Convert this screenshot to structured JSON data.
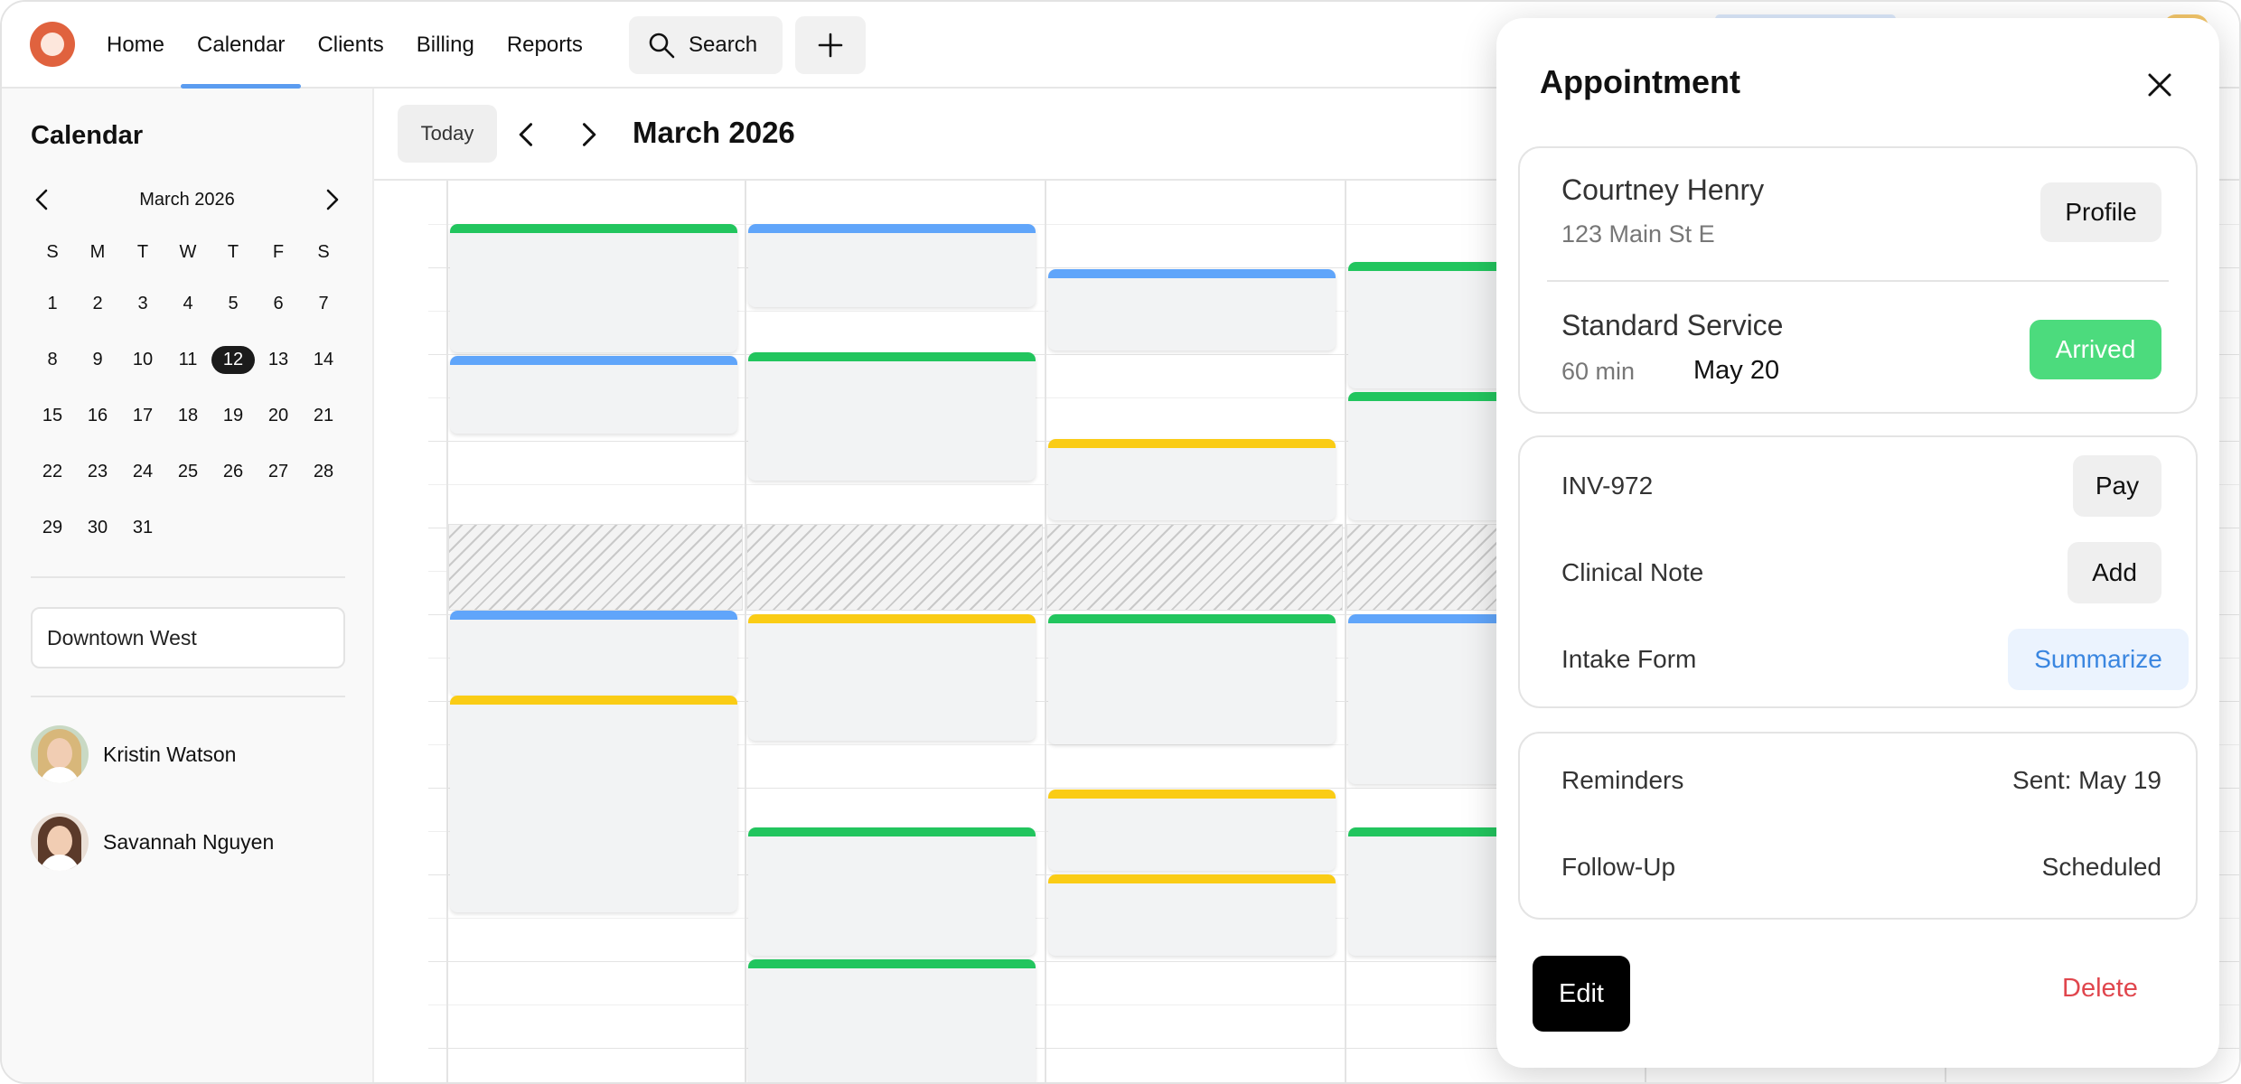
{
  "nav": {
    "items": [
      {
        "label": "Home",
        "active": false
      },
      {
        "label": "Calendar",
        "active": true
      },
      {
        "label": "Clients",
        "active": false
      },
      {
        "label": "Billing",
        "active": false
      },
      {
        "label": "Reports",
        "active": false
      }
    ],
    "search_label": "Search",
    "icons": {
      "search": "search-icon",
      "add": "plus-icon",
      "logo": "app-logo"
    },
    "accent_color": "#5b9cf0"
  },
  "sidebar": {
    "title": "Calendar",
    "mini_calendar": {
      "month_label": "March 2026",
      "weekdays": [
        "S",
        "M",
        "T",
        "W",
        "T",
        "F",
        "S"
      ],
      "days": [
        "1",
        "2",
        "3",
        "4",
        "5",
        "6",
        "7",
        "8",
        "9",
        "10",
        "11",
        "12",
        "13",
        "14",
        "15",
        "16",
        "17",
        "18",
        "19",
        "20",
        "21",
        "22",
        "23",
        "24",
        "25",
        "26",
        "27",
        "28",
        "29",
        "30",
        "31"
      ],
      "selected_day": "12"
    },
    "location_value": "Downtown West",
    "staff": [
      {
        "name": "Kristin Watson"
      },
      {
        "name": "Savannah Nguyen"
      }
    ]
  },
  "toolbar": {
    "today_label": "Today",
    "title": "March 2026"
  },
  "calendar": {
    "status_colors": {
      "green": "#22c55e",
      "blue": "#60a5fa",
      "yellow": "#facc15"
    }
  },
  "panel": {
    "title": "Appointment",
    "client": {
      "name": "Courtney Henry",
      "address": "123 Main St E",
      "profile_label": "Profile"
    },
    "service": {
      "name": "Standard Service",
      "duration": "60 min",
      "date": "May 20",
      "status": "Arrived",
      "status_color": "#4cdb7d"
    },
    "invoice": {
      "label": "INV-972",
      "action": "Pay"
    },
    "clinical_note": {
      "label": "Clinical Note",
      "action": "Add"
    },
    "intake_form": {
      "label": "Intake Form",
      "action": "Summarize"
    },
    "reminders": {
      "label": "Reminders",
      "value": "Sent: May 19"
    },
    "follow_up": {
      "label": "Follow-Up",
      "value": "Scheduled"
    },
    "edit_label": "Edit",
    "delete_label": "Delete"
  }
}
